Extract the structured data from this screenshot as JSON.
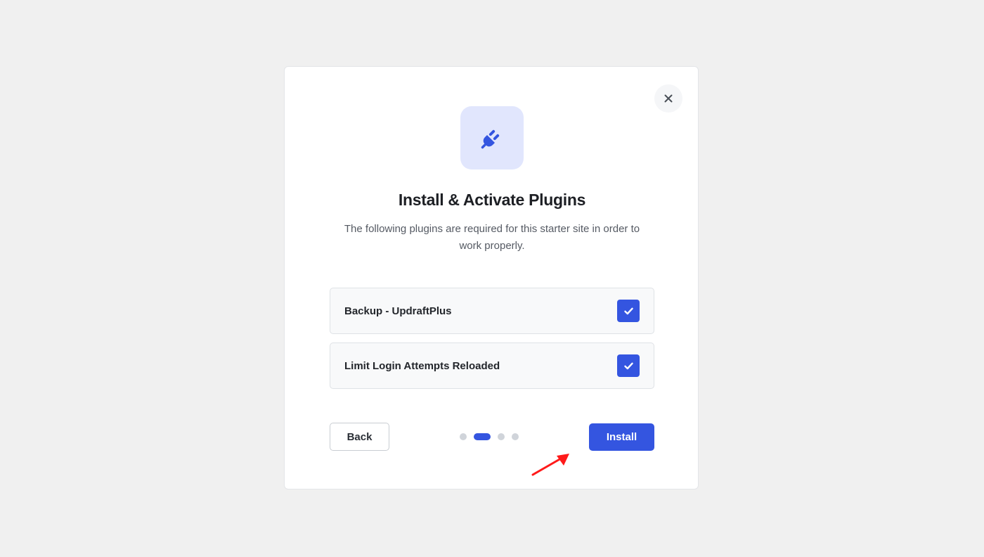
{
  "modal": {
    "close_icon": "close-icon",
    "header_icon": "plug-icon",
    "title": "Install & Activate Plugins",
    "subtitle": "The following plugins are required for this starter site in order to work properly.",
    "plugins": [
      {
        "name": "Backup - UpdraftPlus",
        "checked": true
      },
      {
        "name": "Limit Login Attempts Reloaded",
        "checked": true
      }
    ],
    "back_label": "Back",
    "install_label": "Install",
    "steps": {
      "total": 4,
      "current": 2
    }
  },
  "annotation": {
    "arrow_icon": "red-arrow-icon",
    "arrow_color": "#ff1a1a"
  },
  "colors": {
    "accent": "#3455e0",
    "icon_tile_bg": "#e1e6fd",
    "page_bg": "#f0f0f0"
  }
}
